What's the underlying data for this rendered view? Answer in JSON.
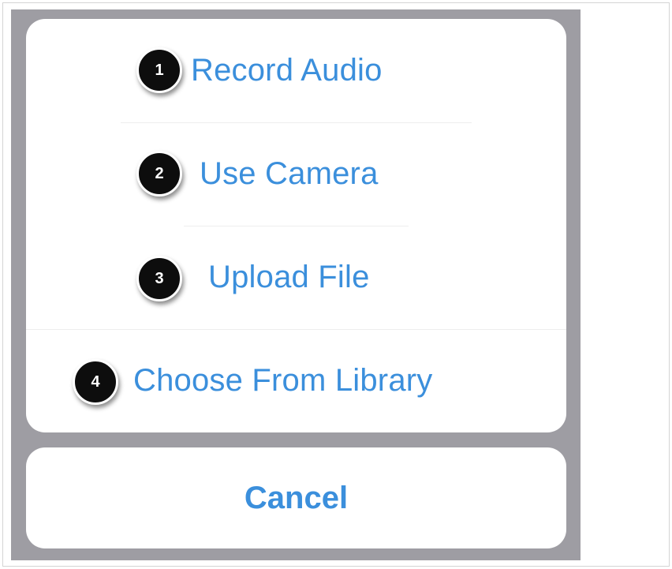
{
  "action_sheet": {
    "actions": [
      {
        "number": "1",
        "label": "Record Audio"
      },
      {
        "number": "2",
        "label": "Use Camera"
      },
      {
        "number": "3",
        "label": "Upload File"
      },
      {
        "number": "4",
        "label": "Choose From Library"
      }
    ],
    "cancel_label": "Cancel"
  },
  "colors": {
    "action_text": "#3b8fdc",
    "backdrop": "#9e9da3",
    "badge_fill": "#0d0d0d"
  }
}
